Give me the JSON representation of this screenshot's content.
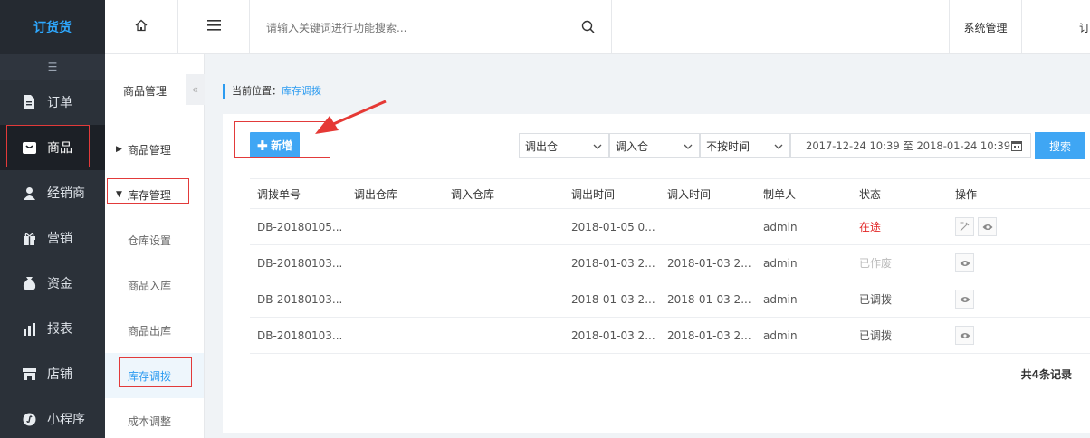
{
  "app": {
    "logo": "订货货"
  },
  "leftnav": {
    "collapse_glyph": "☰",
    "items": [
      {
        "label": "订单",
        "icon": "document-icon"
      },
      {
        "label": "商品",
        "icon": "goods-icon",
        "active": true
      },
      {
        "label": "经销商",
        "icon": "person-icon"
      },
      {
        "label": "营销",
        "icon": "gift-icon"
      },
      {
        "label": "资金",
        "icon": "money-bag-icon"
      },
      {
        "label": "报表",
        "icon": "bar-chart-icon"
      },
      {
        "label": "店铺",
        "icon": "shop-icon"
      },
      {
        "label": "小程序",
        "icon": "miniprogram-icon"
      }
    ]
  },
  "header": {
    "search_placeholder": "请输入关键词进行功能搜索...",
    "system_menu": "系统管理",
    "truncated_menu": "订"
  },
  "subnav": {
    "title": "商品管理",
    "collapse_glyph": "«",
    "groups": [
      {
        "label": "商品管理",
        "caret": "▶"
      },
      {
        "label": "库存管理",
        "caret": "▼"
      }
    ],
    "items": [
      {
        "label": "仓库设置"
      },
      {
        "label": "商品入库"
      },
      {
        "label": "商品出库"
      },
      {
        "label": "库存调拨",
        "active": true
      },
      {
        "label": "成本调整"
      }
    ]
  },
  "breadcrumb": {
    "prefix": "当前位置：",
    "current": "库存调拨"
  },
  "toolbar": {
    "add_label": "✚ 新增",
    "out_warehouse": "调出仓",
    "in_warehouse": "调入仓",
    "time_filter": "不按时间",
    "date_range": "2017-12-24 10:39 至 2018-01-24 10:39",
    "search_label": "搜索"
  },
  "table": {
    "columns": [
      "调拨单号",
      "调出仓库",
      "调入仓库",
      "调出时间",
      "调入时间",
      "制单人",
      "状态",
      "操作"
    ],
    "rows": [
      {
        "no": "DB-20180105...",
        "out_wh": "",
        "in_wh": "",
        "out_time": "2018-01-05 0...",
        "in_time": "",
        "maker": "admin",
        "status": "在途",
        "status_style": "red",
        "ops": [
          "edit-icon",
          "view-icon"
        ]
      },
      {
        "no": "DB-20180103...",
        "out_wh": "",
        "in_wh": "",
        "out_time": "2018-01-03 2...",
        "in_time": "2018-01-03 2...",
        "maker": "admin",
        "status": "已作废",
        "status_style": "gray",
        "ops": [
          "view-icon"
        ]
      },
      {
        "no": "DB-20180103...",
        "out_wh": "",
        "in_wh": "",
        "out_time": "2018-01-03 2...",
        "in_time": "2018-01-03 2...",
        "maker": "admin",
        "status": "已调拨",
        "status_style": "normal",
        "ops": [
          "view-icon"
        ]
      },
      {
        "no": "DB-20180103...",
        "out_wh": "",
        "in_wh": "",
        "out_time": "2018-01-03 2...",
        "in_time": "2018-01-03 2...",
        "maker": "admin",
        "status": "已调拨",
        "status_style": "normal",
        "ops": [
          "view-icon"
        ]
      }
    ],
    "total": "共4条记录"
  },
  "colors": {
    "accent": "#3fa6f4",
    "nav_bg": "#2b3139",
    "highlight_box": "#e23a3a",
    "status_red": "#e22727",
    "arrow": "#e53935"
  }
}
